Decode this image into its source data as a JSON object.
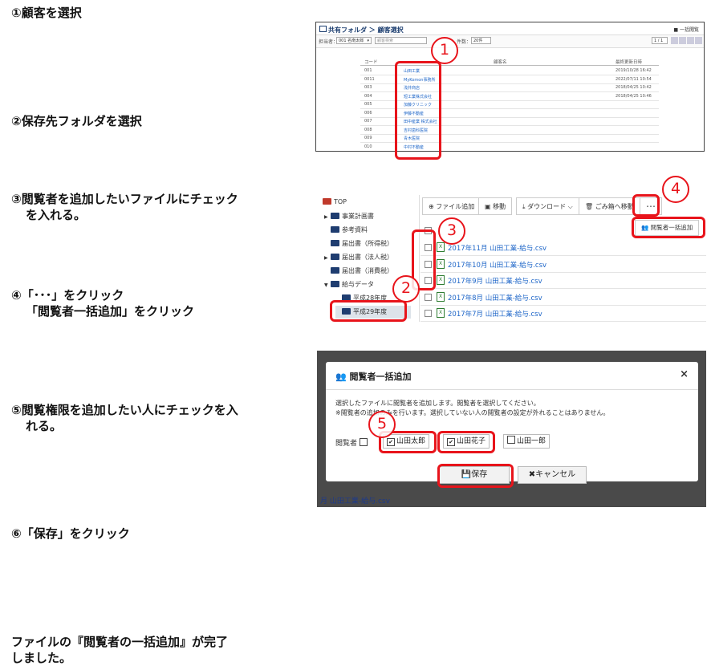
{
  "steps": {
    "s1": "①顧客を選択",
    "s2": "②保存先フォルダを選択",
    "s3a": "③閲覧者を追加したいファイルにチェック",
    "s3b": "を入れる。",
    "s4a": "④「･･･」をクリック",
    "s4b": "「閲覧者一括追加」をクリック",
    "s5a": "⑤閲覧権限を追加したい人にチェックを入",
    "s5b": "れる。",
    "s6": "⑥「保存」をクリック",
    "doneA": "ファイルの『閲覧者の一括追加』が完了",
    "doneB": "しました。"
  },
  "markers": {
    "m1": "1",
    "m2": "2",
    "m3": "3",
    "m4": "4",
    "m5": "5"
  },
  "shot1": {
    "breadcrumb": "共有フォルダ ＞ 顧客選択",
    "right_link": "一括閲覧",
    "staff_label": "担当者：",
    "staff_value": "001 名南太郎",
    "search_placeholder": "顧客検索",
    "count_label": "件数：",
    "count_value": "20件",
    "page": "1 / 1",
    "col_code": "コード",
    "col_name": "顧客名",
    "col_updated": "最終更新日時",
    "rows": [
      {
        "code": "001",
        "name": "山田工業",
        "date": "2019/10/28 16:42"
      },
      {
        "code": "0011",
        "name": "MyKomon事務所",
        "date": "2022/07/11 10:54"
      },
      {
        "code": "003",
        "name": "浅井商店",
        "date": "2018/04/25 10:42"
      },
      {
        "code": "004",
        "name": "短工業株式会社",
        "date": "2018/04/25 10:46"
      },
      {
        "code": "005",
        "name": "加藤クリニック",
        "date": ""
      },
      {
        "code": "006",
        "name": "伊藤不動産",
        "date": ""
      },
      {
        "code": "007",
        "name": "田中産業 株式会社",
        "date": ""
      },
      {
        "code": "008",
        "name": "吉村歯科医院",
        "date": ""
      },
      {
        "code": "009",
        "name": "青木医院",
        "date": ""
      },
      {
        "code": "010",
        "name": "中村不動産",
        "date": ""
      }
    ]
  },
  "shot2": {
    "tree": [
      {
        "label": "TOP"
      },
      {
        "label": "事業計画書"
      },
      {
        "label": "参考資料"
      },
      {
        "label": "届出書（所得税）"
      },
      {
        "label": "届出書（法人税）"
      },
      {
        "label": "届出書（消費税）"
      },
      {
        "label": "給与データ"
      },
      {
        "label": "平成28年度"
      },
      {
        "label": "平成29年度"
      }
    ],
    "toolbar": {
      "add_file": "ファイル追加",
      "move": "移動",
      "download": "ダウンロード",
      "trash": "ごみ箱へ移動",
      "more": "･･･"
    },
    "bulk_add": "閲覧者一括追加",
    "files": [
      {
        "name": "2017年11月 山田工業-給与.csv"
      },
      {
        "name": "2017年10月 山田工業-給与.csv"
      },
      {
        "name": "2017年9月 山田工業-給与.csv"
      },
      {
        "name": "2017年8月 山田工業-給与.csv"
      },
      {
        "name": "2017年7月 山田工業-給与.csv"
      }
    ]
  },
  "shot3": {
    "bg_fragment": "月 山田工業-給与.csv",
    "modal_title": "閲覧者一括追加",
    "close": "×",
    "desc1": "選択したファイルに閲覧者を追加します。閲覧者を選択してください。",
    "desc2": "※閲覧者の追加のみを行います。選択していない人の閲覧者の設定が外れることはありません。",
    "viewer_label": "閲覧者",
    "people": [
      {
        "name": "山田太郎",
        "checked": "✔"
      },
      {
        "name": "山田花子",
        "checked": "✔"
      },
      {
        "name": "山田一郎",
        "checked": ""
      }
    ],
    "save": "保存",
    "cancel": "キャンセル"
  }
}
